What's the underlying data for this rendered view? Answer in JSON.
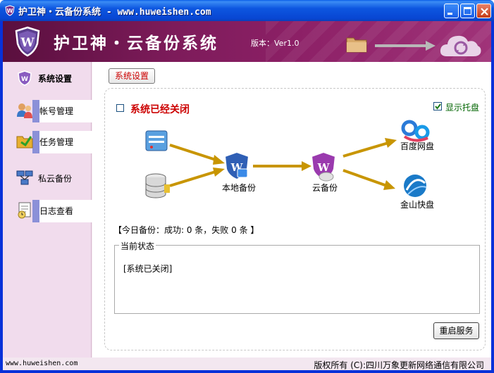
{
  "window": {
    "title": "护卫神・云备份系统 - www.huweishen.com"
  },
  "banner": {
    "title": "护卫神・云备份系统",
    "version": "版本：Ver1.0"
  },
  "sidebar": {
    "items": [
      {
        "label": "系统设置",
        "icon": "shield-w-icon"
      },
      {
        "label": "帐号管理",
        "icon": "users-icon"
      },
      {
        "label": "任务管理",
        "icon": "folder-icon"
      },
      {
        "label": "私云备份",
        "icon": "network-icon"
      },
      {
        "label": "日志查看",
        "icon": "log-icon"
      }
    ]
  },
  "main": {
    "tab_label": "系统设置",
    "status_label": "系统已经关闭",
    "status_checked": false,
    "tray_label": "显示托盘",
    "tray_checked": true,
    "flow": {
      "local_label": "本地备份",
      "cloud_label": "云备份",
      "baidu_label": "百度网盘",
      "kingsoft_label": "金山快盘"
    },
    "today_text": "【今日备份：成功: 0 条，失败 0 条 】",
    "state_legend": "当前状态",
    "state_text": "[系统已关闭]",
    "restart_label": "重启服务"
  },
  "statusbar": {
    "site": "www.huweishen.com",
    "copyright": "版权所有 (C):四川万象更新网络通信有限公司"
  },
  "colors": {
    "banner": "#7d1b5a",
    "sidebar": "#f1dced",
    "accent_red": "#cc0000",
    "tray_green": "#006400",
    "arrow_gold": "#c89500"
  }
}
